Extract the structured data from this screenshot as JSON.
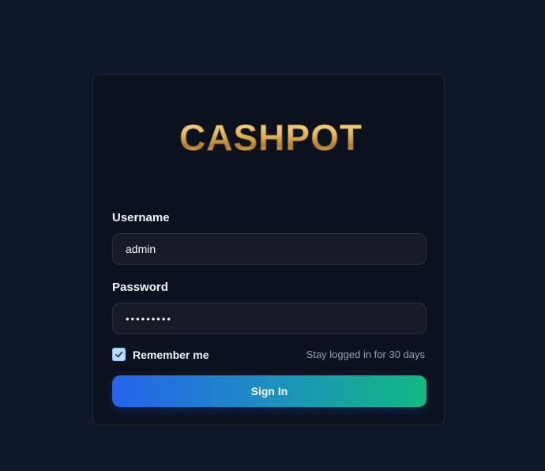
{
  "logo": {
    "text": "CASHPOT",
    "icon": "spade-icon",
    "color_light": "#f3d98a",
    "color_dark": "#a8782f"
  },
  "form": {
    "username": {
      "label": "Username",
      "value": "admin"
    },
    "password": {
      "label": "Password",
      "value": "•••••••••"
    },
    "remember": {
      "label": "Remember me",
      "checked": true,
      "hint": "Stay logged in for 30 days"
    },
    "submit_label": "Sign In"
  },
  "colors": {
    "page_bg": "#0f172a",
    "card_bg": "#0b111d",
    "button_start": "#2563eb",
    "button_end": "#10b981"
  }
}
